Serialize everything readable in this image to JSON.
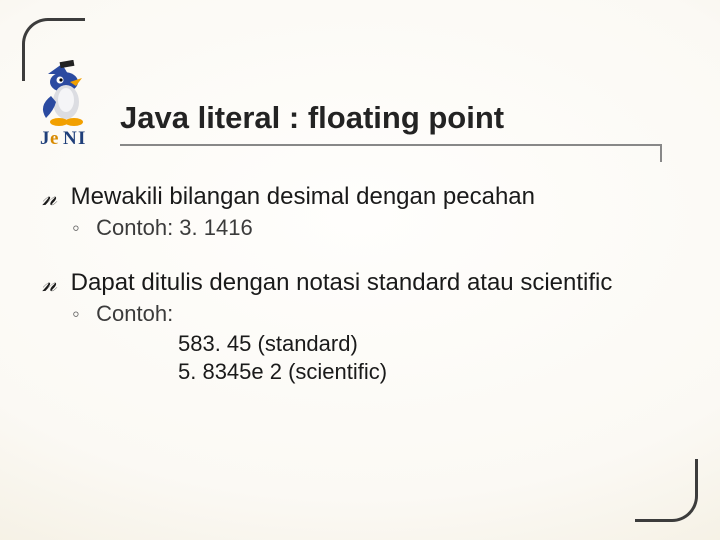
{
  "title": "Java literal : floating point",
  "logo_text": "JeNI",
  "bullets": [
    {
      "text": "Mewakili bilangan desimal dengan pecahan",
      "sub": "Contoh: 3. 1416"
    },
    {
      "text": "Dapat ditulis dengan notasi standard atau scientific",
      "sub": "Contoh:",
      "examples": [
        "583. 45 (standard)",
        "5. 8345e 2 (scientific)"
      ]
    }
  ]
}
